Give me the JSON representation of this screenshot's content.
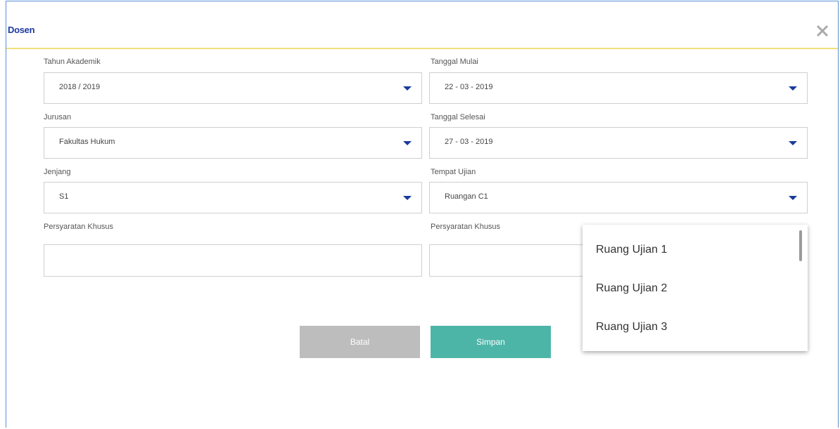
{
  "modal": {
    "title": "Dosen",
    "close_icon": "close-icon"
  },
  "left_fields": [
    {
      "label": "Tahun Akademik",
      "value": "2018 / 2019"
    },
    {
      "label": "Jurusan",
      "value": "Fakultas Hukum"
    },
    {
      "label": "Jenjang",
      "value": "S1"
    },
    {
      "label": "Persyaratan Khusus",
      "value": ""
    }
  ],
  "right_fields": [
    {
      "label": "Tanggal Mulai",
      "value": "22 - 03 - 2019"
    },
    {
      "label": "Tanggal Selesai",
      "value": "27 - 03 - 2019"
    },
    {
      "label": "Tempat Ujian",
      "value": "Ruangan C1"
    },
    {
      "label": "Persyaratan Khusus",
      "value": ""
    }
  ],
  "buttons": {
    "cancel": "Batal",
    "save": "Simpan"
  },
  "dropdown": {
    "items": [
      "Ruang Ujian 1",
      "Ruang Ujian 2",
      "Ruang Ujian 3"
    ]
  },
  "colors": {
    "title": "#1c3aa0",
    "caret": "#1a3a9c",
    "header_border": "#f2e07a",
    "cancel_bg": "#bdbdbd",
    "save_bg": "#4cb5a8"
  }
}
